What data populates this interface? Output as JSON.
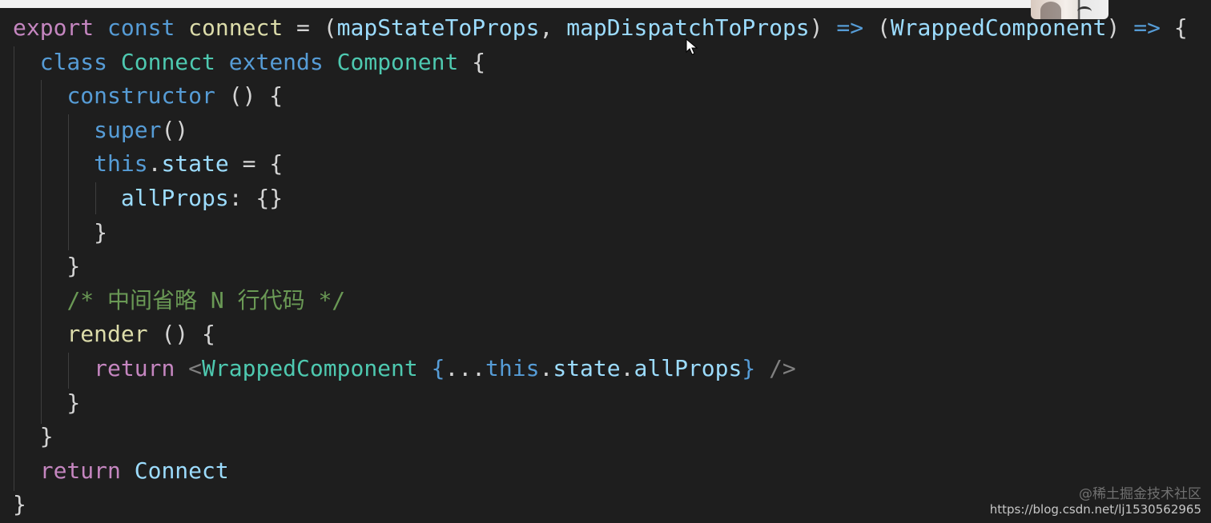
{
  "code_lines": [
    [
      {
        "t": "export",
        "c": "kw-purple"
      },
      {
        "t": " ",
        "c": "punc"
      },
      {
        "t": "const",
        "c": "kw-blue"
      },
      {
        "t": " ",
        "c": "punc"
      },
      {
        "t": "connect",
        "c": "fn"
      },
      {
        "t": " = (",
        "c": "punc"
      },
      {
        "t": "mapStateToProps",
        "c": "param"
      },
      {
        "t": ", ",
        "c": "punc"
      },
      {
        "t": "mapDispatchToProps",
        "c": "param"
      },
      {
        "t": ") ",
        "c": "punc"
      },
      {
        "t": "=>",
        "c": "op"
      },
      {
        "t": " (",
        "c": "punc"
      },
      {
        "t": "WrappedComponent",
        "c": "param"
      },
      {
        "t": ") ",
        "c": "punc"
      },
      {
        "t": "=>",
        "c": "op"
      },
      {
        "t": " {",
        "c": "punc"
      }
    ],
    [
      {
        "t": "  ",
        "c": "punc"
      },
      {
        "t": "class",
        "c": "kw-blue"
      },
      {
        "t": " ",
        "c": "punc"
      },
      {
        "t": "Connect",
        "c": "type"
      },
      {
        "t": " ",
        "c": "punc"
      },
      {
        "t": "extends",
        "c": "kw-blue"
      },
      {
        "t": " ",
        "c": "punc"
      },
      {
        "t": "Component",
        "c": "type"
      },
      {
        "t": " {",
        "c": "punc"
      }
    ],
    [
      {
        "t": "    ",
        "c": "punc"
      },
      {
        "t": "constructor",
        "c": "kw-blue"
      },
      {
        "t": " () {",
        "c": "punc"
      }
    ],
    [
      {
        "t": "      ",
        "c": "punc"
      },
      {
        "t": "super",
        "c": "kw-blue"
      },
      {
        "t": "()",
        "c": "punc"
      }
    ],
    [
      {
        "t": "      ",
        "c": "punc"
      },
      {
        "t": "this",
        "c": "kw-blue"
      },
      {
        "t": ".",
        "c": "punc"
      },
      {
        "t": "state",
        "c": "param"
      },
      {
        "t": " = {",
        "c": "punc"
      }
    ],
    [
      {
        "t": "        ",
        "c": "punc"
      },
      {
        "t": "allProps",
        "c": "param"
      },
      {
        "t": ": {}",
        "c": "punc"
      }
    ],
    [
      {
        "t": "      }",
        "c": "punc"
      }
    ],
    [
      {
        "t": "    }",
        "c": "punc"
      }
    ],
    [
      {
        "t": "    ",
        "c": "punc"
      },
      {
        "t": "/* 中间省略 N 行代码 */",
        "c": "comment"
      }
    ],
    [
      {
        "t": "    ",
        "c": "punc"
      },
      {
        "t": "render",
        "c": "fn"
      },
      {
        "t": " () {",
        "c": "punc"
      }
    ],
    [
      {
        "t": "      ",
        "c": "punc"
      },
      {
        "t": "return",
        "c": "kw-purple"
      },
      {
        "t": " ",
        "c": "punc"
      },
      {
        "t": "<",
        "c": "tag-punc"
      },
      {
        "t": "WrappedComponent",
        "c": "type"
      },
      {
        "t": " ",
        "c": "punc"
      },
      {
        "t": "{",
        "c": "brace-blue"
      },
      {
        "t": "...",
        "c": "punc"
      },
      {
        "t": "this",
        "c": "kw-blue"
      },
      {
        "t": ".",
        "c": "punc"
      },
      {
        "t": "state",
        "c": "param"
      },
      {
        "t": ".",
        "c": "punc"
      },
      {
        "t": "allProps",
        "c": "param"
      },
      {
        "t": "}",
        "c": "brace-blue"
      },
      {
        "t": " ",
        "c": "punc"
      },
      {
        "t": "/>",
        "c": "tag-punc"
      }
    ],
    [
      {
        "t": "    }",
        "c": "punc"
      }
    ],
    [
      {
        "t": "  }",
        "c": "punc"
      }
    ],
    [
      {
        "t": "  ",
        "c": "punc"
      },
      {
        "t": "return",
        "c": "kw-purple"
      },
      {
        "t": " ",
        "c": "punc"
      },
      {
        "t": "Connect",
        "c": "param"
      }
    ],
    [
      {
        "t": "}",
        "c": "punc"
      }
    ]
  ],
  "watermark": {
    "line1": "@稀土掘金技术社区",
    "line2": "https://blog.csdn.net/lj1530562965"
  },
  "colors": {
    "background": "#1e1e1e",
    "keyword_purple": "#c586c0",
    "keyword_blue": "#569cd6",
    "function": "#dcdcaa",
    "parameter": "#9cdcfe",
    "type": "#4ec9b0",
    "comment": "#6a9955"
  },
  "icons": {
    "cursor": "mouse-pointer-icon",
    "thumbnail": "video-thumbnail"
  }
}
